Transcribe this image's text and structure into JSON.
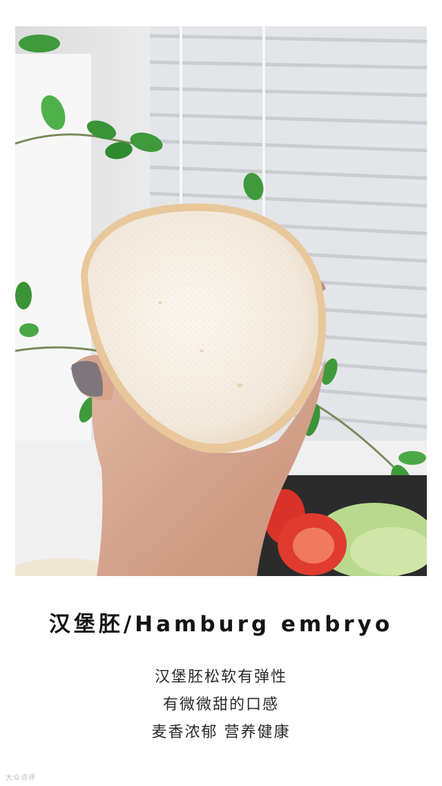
{
  "photo": {
    "subject": "hamburger-bun-slice-in-hand",
    "colors": {
      "crumb": "#f4ece0",
      "crust": "#e8c79a",
      "leaf": "#3f9a3c",
      "tomato": "#d8322a",
      "lettuce": "#b9d98f",
      "skin": "#d9aa95",
      "blinds": "#dfe1e4"
    }
  },
  "caption": {
    "title": "汉堡胚/Hamburg embryo",
    "lines": [
      "汉堡胚松软有弹性",
      "有微微甜的口感",
      "麦香浓郁 营养健康"
    ]
  },
  "watermark": "大众点评"
}
